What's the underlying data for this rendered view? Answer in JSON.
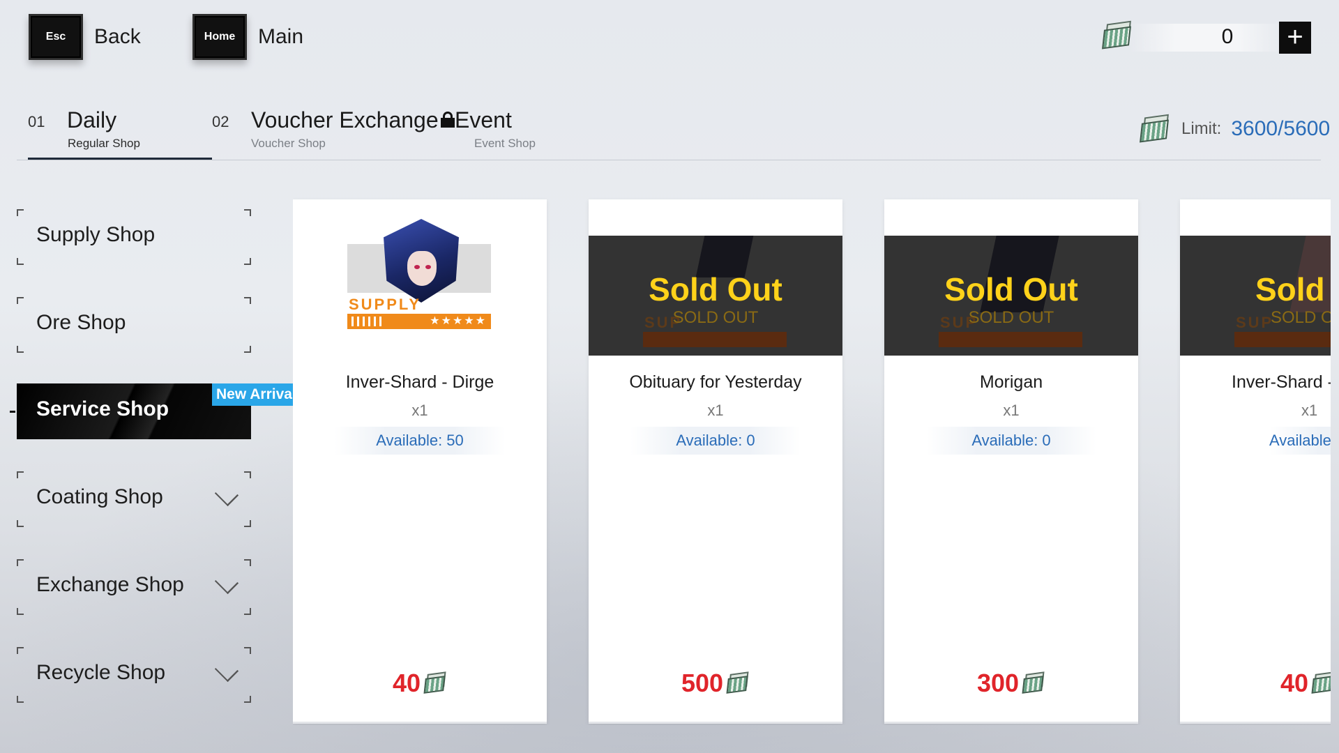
{
  "top_bar": {
    "back": {
      "key": "Esc",
      "label": "Back"
    },
    "home": {
      "key": "Home",
      "label": "Main"
    },
    "currency": {
      "amount": "0",
      "icon": "voucher-icon",
      "plus": "+"
    }
  },
  "tabs": [
    {
      "num": "01",
      "title": "Daily",
      "subtitle": "Regular Shop"
    },
    {
      "num": "02",
      "title": "Voucher Exchange",
      "subtitle": "Voucher Shop"
    },
    {
      "num": "",
      "title": "Event",
      "subtitle": "Event Shop",
      "icon": "lock-icon"
    }
  ],
  "limit": {
    "label": "Limit:",
    "value": "3600/5600"
  },
  "side_menu": {
    "items": [
      {
        "label": "Supply Shop"
      },
      {
        "label": "Ore Shop"
      },
      {
        "label": "Service Shop",
        "badge": "New Arrivals"
      },
      {
        "label": "Coating Shop"
      },
      {
        "label": "Exchange Shop"
      },
      {
        "label": "Recycle Shop"
      }
    ]
  },
  "cards": [
    {
      "name": "Inver-Shard - Dirge",
      "qty": "x1",
      "available": "Available: 50",
      "price": "40",
      "sold_out": false,
      "supply": "SUPPLY",
      "stars": "★★★★★"
    },
    {
      "name": "Obituary for Yesterday",
      "qty": "x1",
      "available": "Available: 0",
      "price": "500",
      "sold_out": true,
      "sold_big": "Sold Out",
      "sold_small": "SOLD OUT",
      "supply": "SUP"
    },
    {
      "name": "Morigan",
      "qty": "x1",
      "available": "Available: 0",
      "price": "300",
      "sold_out": true,
      "sold_big": "Sold Out",
      "sold_small": "SOLD OUT",
      "supply": "SUP"
    },
    {
      "name": "Inver-Shard - :",
      "qty": "x1",
      "available": "Available:",
      "price": "40",
      "sold_out": true,
      "sold_big": "Sold O",
      "sold_small": "SOLD OU",
      "supply": "SUP"
    }
  ],
  "colors": {
    "accent_blue": "#2a6cb8",
    "price_red": "#e0242a",
    "sold_yellow": "#ffd21a",
    "badge_blue": "#2aa6e8",
    "supply_orange": "#f08a1a"
  }
}
